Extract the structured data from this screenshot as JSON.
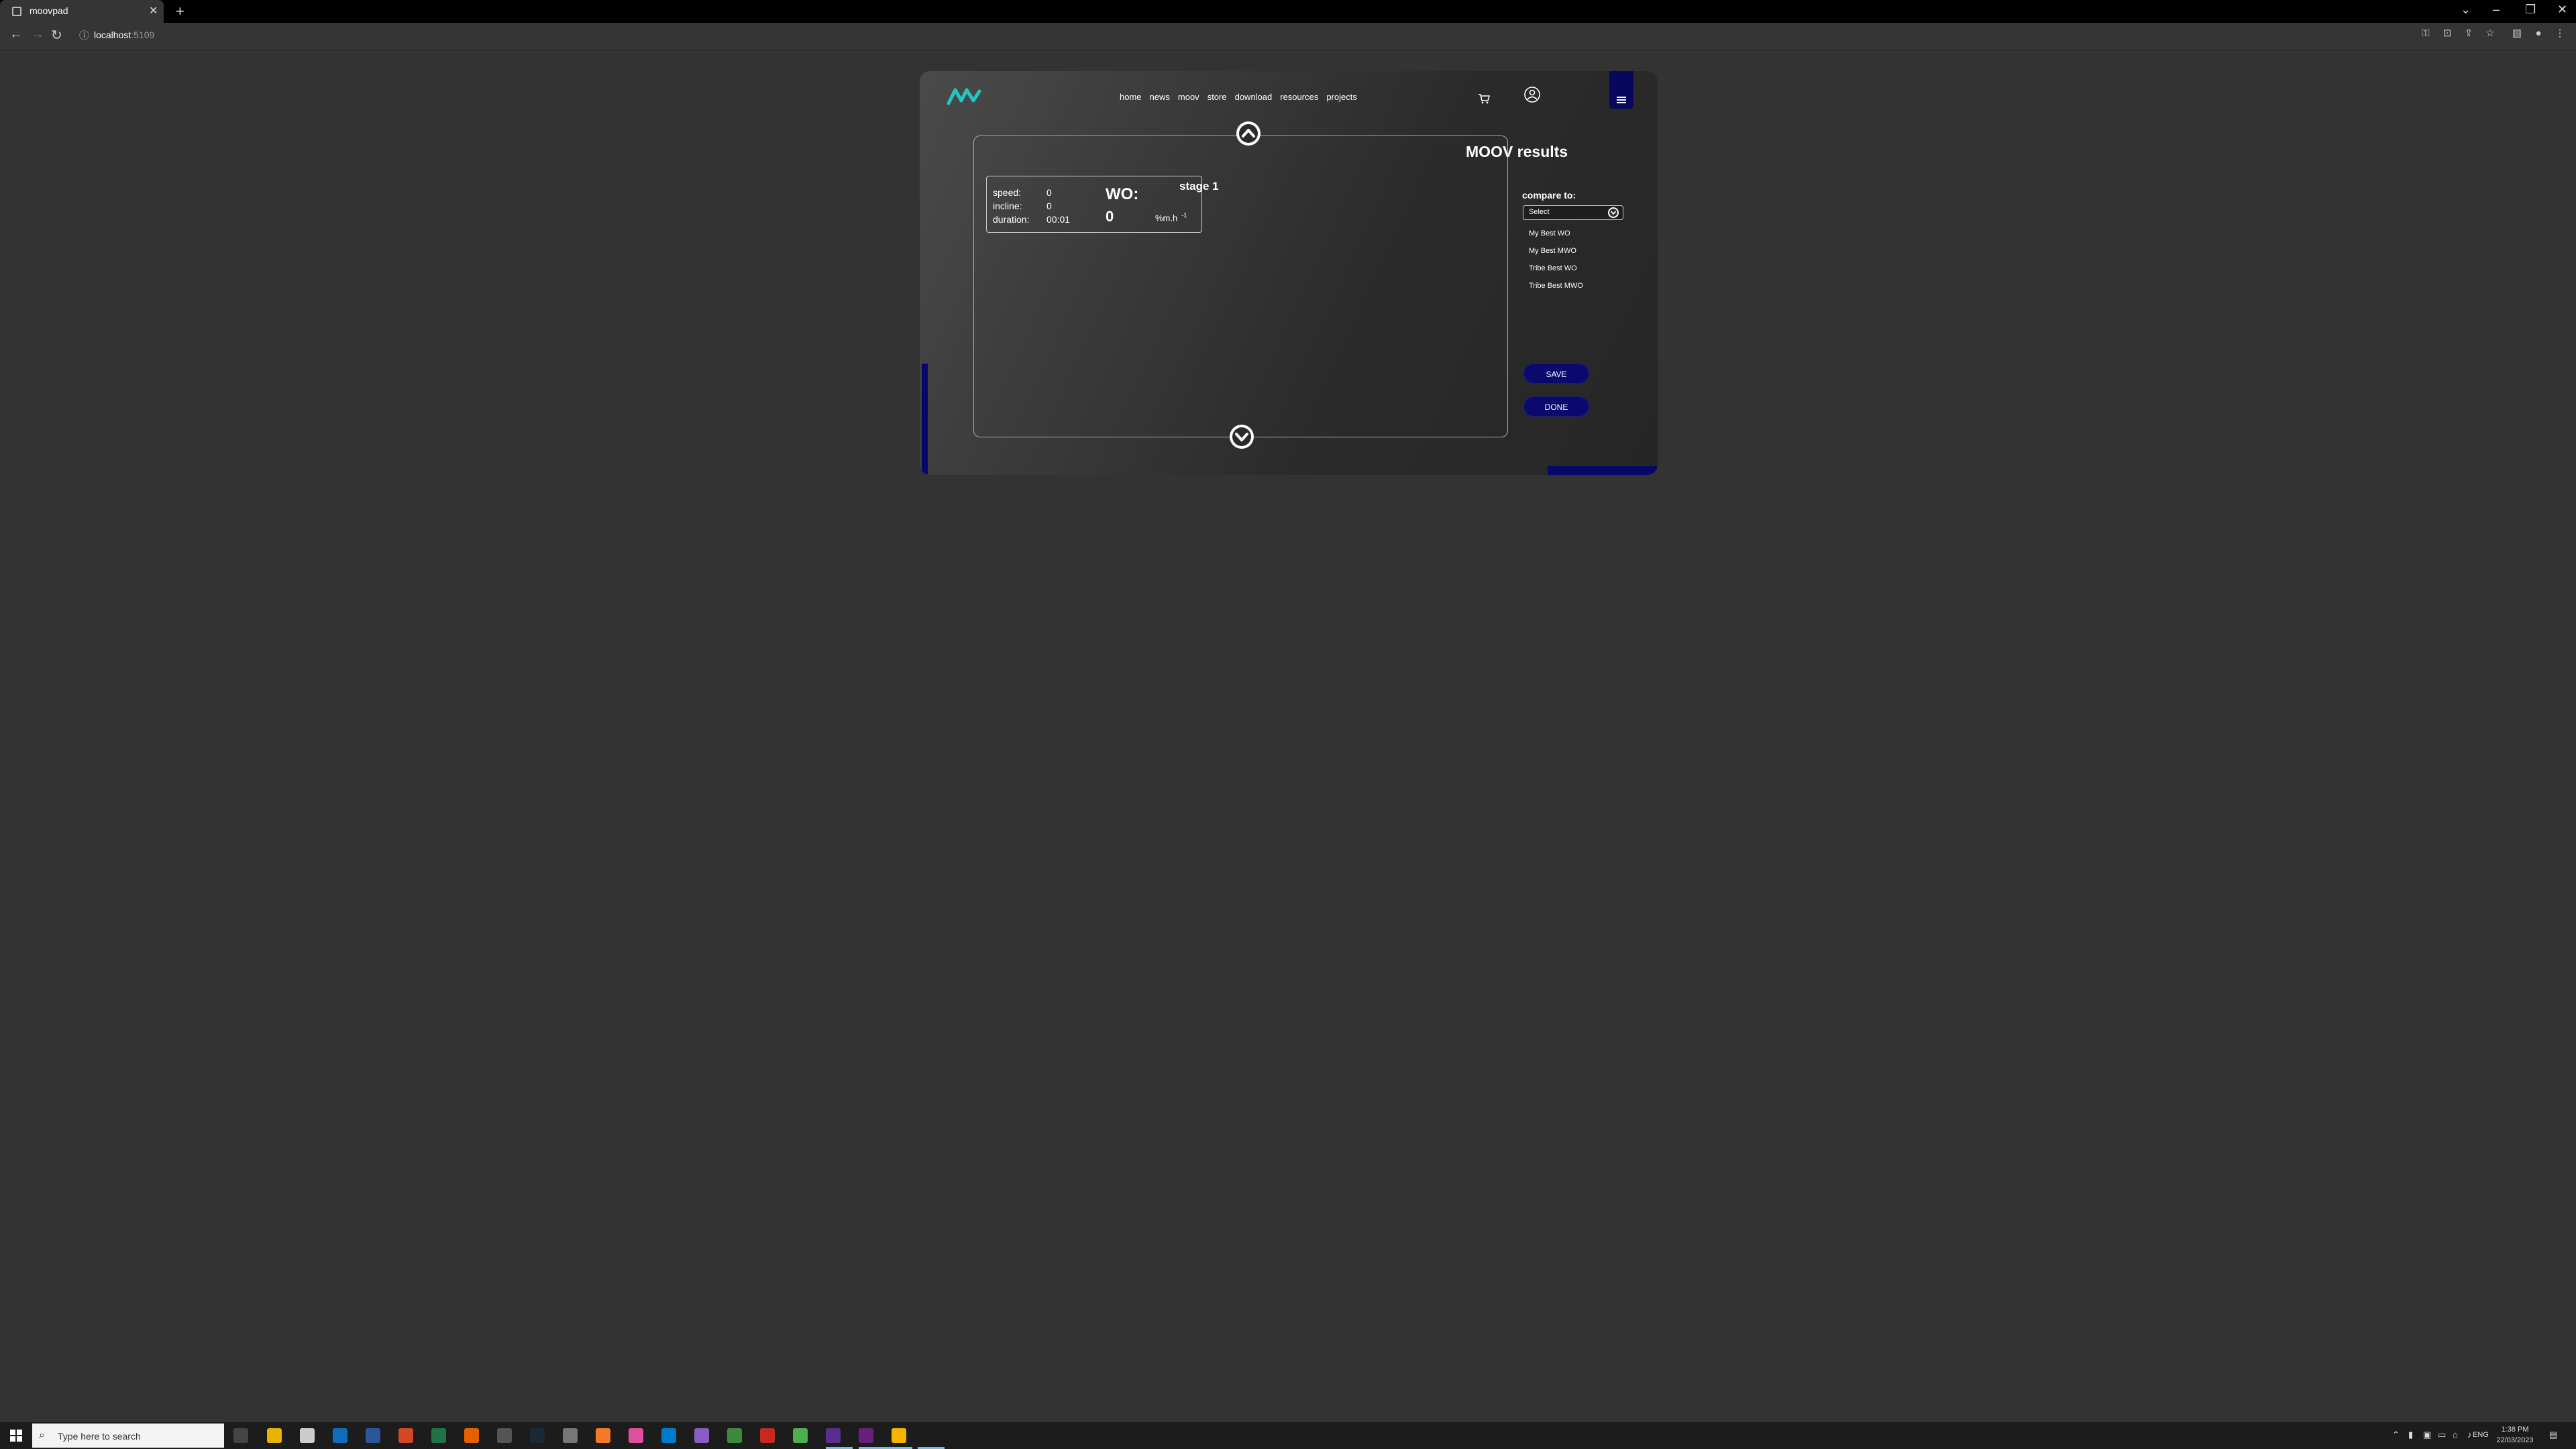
{
  "browser": {
    "tab_title": "moovpad",
    "new_tab": "+",
    "url_host": "localhost",
    "url_port": ":5109",
    "window_controls": [
      "⌄",
      "–",
      "❐",
      "✕"
    ]
  },
  "app": {
    "nav": [
      "home",
      "news",
      "moov",
      "store",
      "download",
      "resources",
      "projects"
    ],
    "stats": [
      {
        "label": "speed:",
        "value": "0"
      },
      {
        "label": "incline:",
        "value": "0"
      },
      {
        "label": "duration:",
        "value": "00:01"
      }
    ],
    "wo_label": "WO:",
    "wo_value": "0",
    "wo_unit": "%m.h",
    "wo_unit_sup": "-1",
    "stage_title": "stage 1",
    "results_title": "MOOV results",
    "compare_label": "compare to:",
    "compare_selected": "Select",
    "compare_options": [
      "My Best WO",
      "My Best MWO",
      "Tribe Best WO",
      "Tribe Best MWO"
    ],
    "save_label": "SAVE",
    "done_label": "DONE",
    "accent_color": "#06066b",
    "logo_color": "#1fc7c7"
  },
  "taskbar": {
    "search_placeholder": "Type here to search",
    "time": "1:38 PM",
    "date": "22/03/2023",
    "lang": "ENG"
  }
}
